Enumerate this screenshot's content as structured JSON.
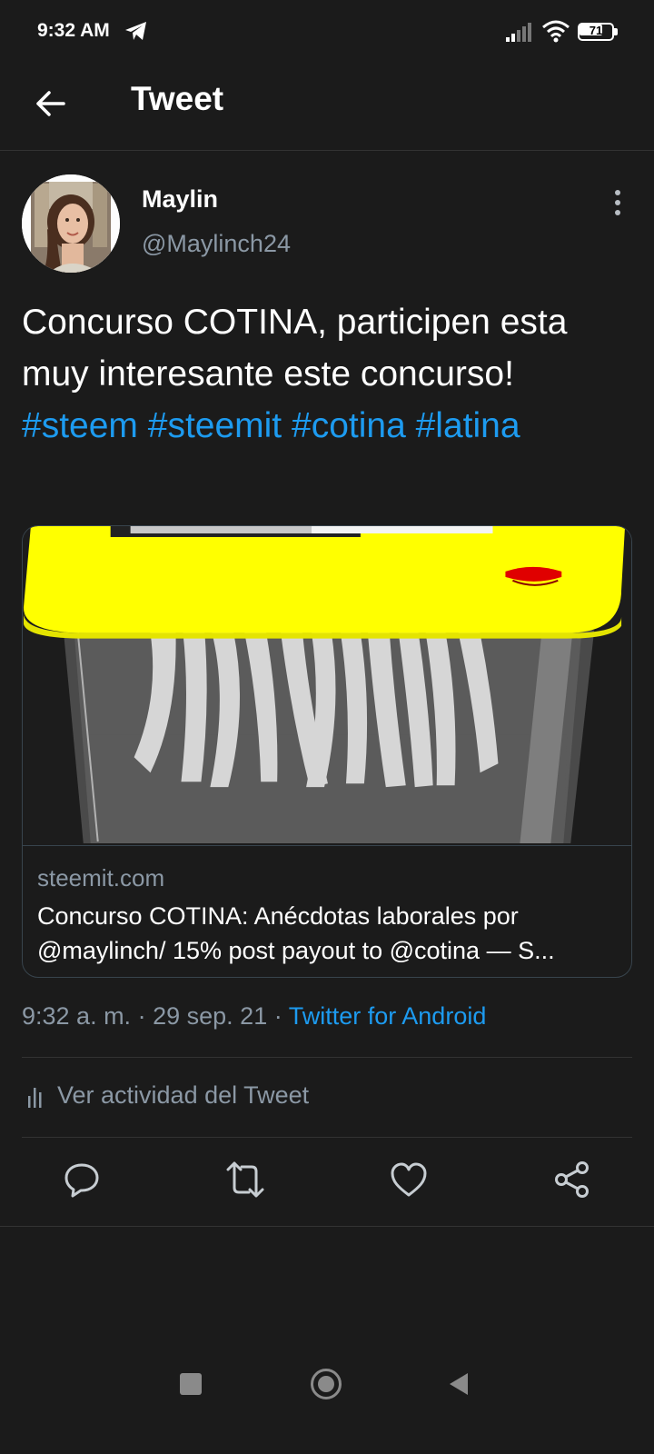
{
  "status_bar": {
    "time": "9:32 AM",
    "battery": "71",
    "icons": [
      "telegram-icon",
      "signal-icon",
      "wifi-icon",
      "battery-icon"
    ]
  },
  "header": {
    "title": "Tweet",
    "back_icon": "arrow-left-icon"
  },
  "tweet": {
    "author_name": "Maylin",
    "author_handle": "@Maylinch24",
    "text_plain": "Concurso COTINA, participen esta muy interesante este concurso!",
    "hashtags": [
      "#steem",
      "#steemit",
      "#cotina",
      "#latina"
    ],
    "timestamp": "9:32 a. m.",
    "separator": "·",
    "date": "29 sep. 21",
    "source": "Twitter for Android"
  },
  "link_card": {
    "domain": "steemit.com",
    "title_line1": "Concurso COTINA: Anécdotas laborales por",
    "title_line2": "@maylinch/ 15% post payout to @cotina — S..."
  },
  "activity": {
    "label": "Ver actividad del Tweet"
  },
  "actions": [
    "reply-icon",
    "retweet-icon",
    "like-icon",
    "share-icon"
  ],
  "colors": {
    "background": "#1b1b1b",
    "link": "#1d9bf0",
    "secondary_text": "#8b98a5"
  }
}
